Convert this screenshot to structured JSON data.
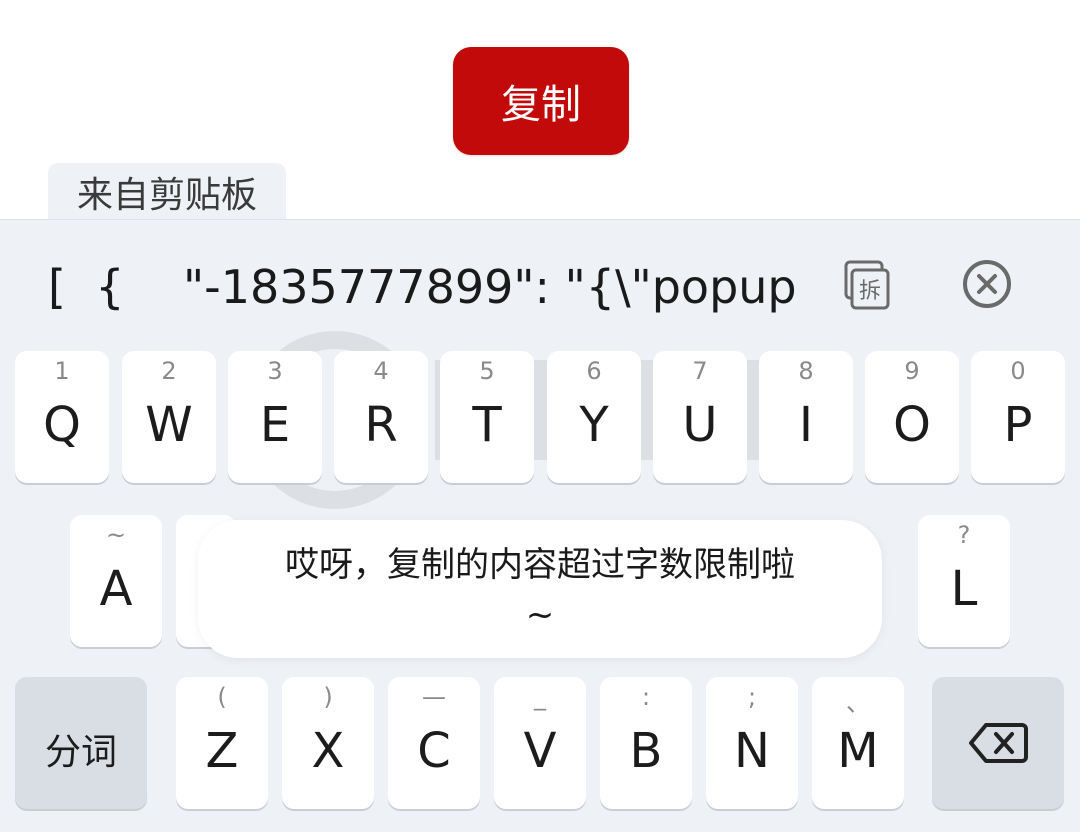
{
  "app": {
    "copy_button_label": "复制"
  },
  "clipboard": {
    "tab_label": "来自剪贴板",
    "content": "[  {    \"-1835777899\": \"{\\\"popup"
  },
  "keyboard": {
    "row1": [
      {
        "letter": "Q",
        "hint": "1"
      },
      {
        "letter": "W",
        "hint": "2"
      },
      {
        "letter": "E",
        "hint": "3"
      },
      {
        "letter": "R",
        "hint": "4"
      },
      {
        "letter": "T",
        "hint": "5"
      },
      {
        "letter": "Y",
        "hint": "6"
      },
      {
        "letter": "U",
        "hint": "7"
      },
      {
        "letter": "I",
        "hint": "8"
      },
      {
        "letter": "O",
        "hint": "9"
      },
      {
        "letter": "P",
        "hint": "0"
      }
    ],
    "row2_left": {
      "letter": "A",
      "hint": "~"
    },
    "row2_right": {
      "letter": "L",
      "hint": "?"
    },
    "row3": [
      {
        "letter": "Z",
        "hint": "("
      },
      {
        "letter": "X",
        "hint": ")"
      },
      {
        "letter": "C",
        "hint": "—"
      },
      {
        "letter": "V",
        "hint": "_"
      },
      {
        "letter": "B",
        "hint": ":"
      },
      {
        "letter": "N",
        "hint": ";"
      },
      {
        "letter": "M",
        "hint": "、"
      }
    ],
    "segment_key_label": "分词",
    "colors": {
      "background": "#eef1f6",
      "key": "#ffffff",
      "function_key": "#d9dde4",
      "accent": "#c20a0a"
    }
  },
  "toast": {
    "line1": "哎呀，复制的内容超过字数限制啦",
    "line2": "~"
  },
  "icons": {
    "split": "split-text-icon",
    "close": "close-circle-icon",
    "backspace": "backspace-icon"
  }
}
